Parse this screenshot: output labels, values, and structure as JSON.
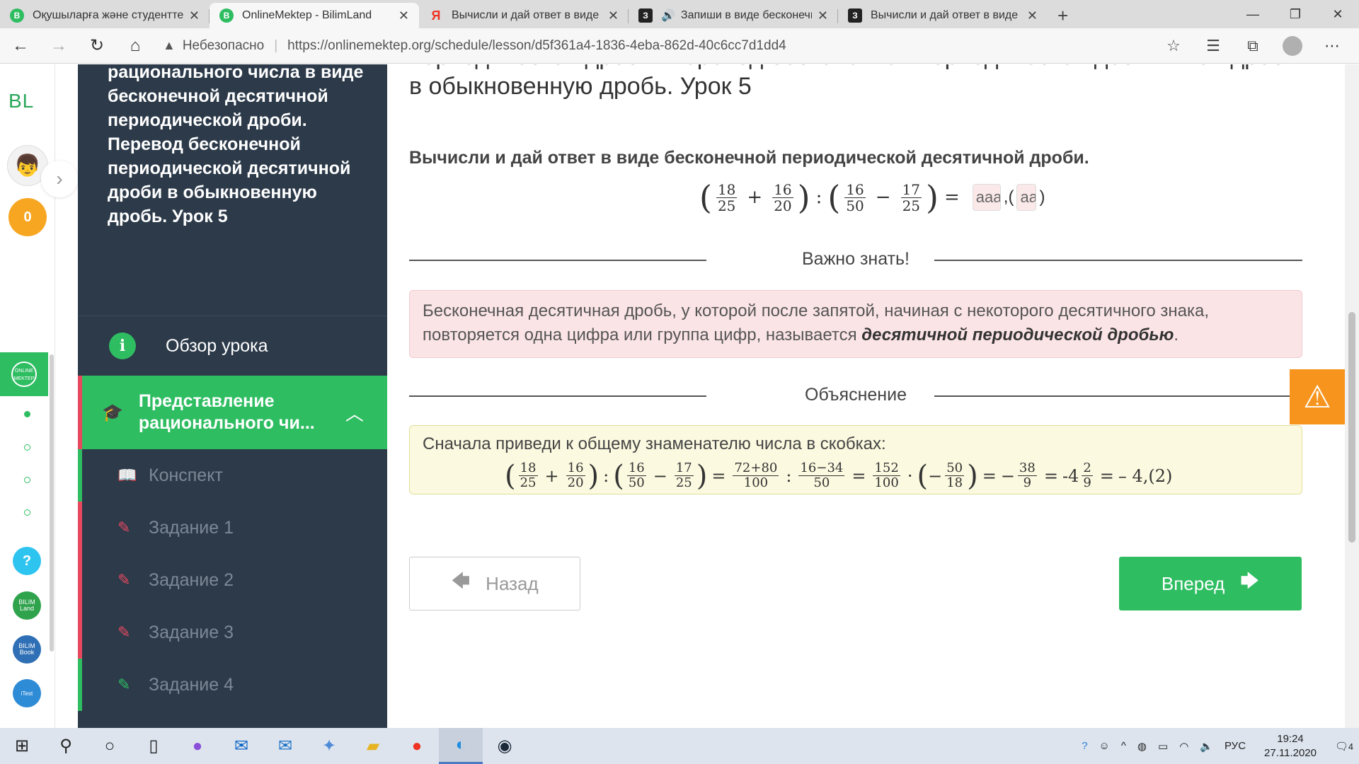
{
  "browser": {
    "tabs": [
      {
        "title": "Оқушыларға және студенттерге",
        "icon_color": "#2fbd62",
        "icon_glyph": "B",
        "active": false
      },
      {
        "title": "OnlineMektep - BilimLand",
        "icon_color": "#2fbd62",
        "icon_glyph": "B",
        "active": true
      },
      {
        "title": "Вычисли и дай ответ в виде бес",
        "icon_color": "#e32",
        "icon_glyph": "Я",
        "active": false
      },
      {
        "title": "Запиши в виде бесконечн",
        "icon_color": "#222",
        "icon_glyph": "З",
        "active": false
      },
      {
        "title": "Вычисли и дай ответ в виде бе",
        "icon_color": "#222",
        "icon_glyph": "З",
        "active": false
      }
    ],
    "insecure_label": "Небезопасно",
    "url": "https://onlinemektep.org/schedule/lesson/d5f361a4-1836-4eba-862d-40c6cc7d1dd4"
  },
  "rail": {
    "logo": "BL",
    "coins": "0",
    "online_mektep_badge": "ONLINE MEKTEP",
    "help": "?",
    "bilimland": "BILIM Land",
    "bilimbook": "BILIM Book",
    "itest": "iTest"
  },
  "sidebar": {
    "title": "Представление рационального числа в виде бесконечной десятичной периодической дроби. Перевод бесконечной периодической десятичной дроби в обыкновенную дробь. Урок 5",
    "overview_label": "Обзор урока",
    "section_label": "Представление рационального чи...",
    "items": [
      {
        "label": "Конспект",
        "icon": "book-icon",
        "bar": "#2fbd62"
      },
      {
        "label": "Задание 1",
        "icon": "edit-icon",
        "bar": "#e8485f"
      },
      {
        "label": "Задание 2",
        "icon": "edit-icon",
        "bar": "#e8485f"
      },
      {
        "label": "Задание 3",
        "icon": "edit-icon",
        "bar": "#e8485f"
      },
      {
        "label": "Задание 4",
        "icon": "edit-icon",
        "bar": "#2fbd62"
      }
    ]
  },
  "main": {
    "lesson_title": "периодической дроби. Перевод бесконечной периодической десятичной дроби в обыкновенную дробь. Урок 5",
    "question": "Вычисли и дай ответ в виде бесконечной периодической десятичной дроби.",
    "formula": {
      "f1": {
        "num": "18",
        "den": "25"
      },
      "f2": {
        "num": "16",
        "den": "20"
      },
      "f3": {
        "num": "16",
        "den": "50"
      },
      "f4": {
        "num": "17",
        "den": "25"
      },
      "answer1_value": "aaa",
      "answer2_value": "aa",
      "comma_paren": ",(",
      "close_paren": ")"
    },
    "important_label": "Важно знать!",
    "note_text": "Бесконечная десятичная дробь, у которой после запятой, начиная с некоторого десятичного знака, повторяется одна цифра или группа цифр, называется ",
    "note_term": "десятичной периодической дробью",
    "note_end": ".",
    "explanation_label": "Объяснение",
    "explanation_text": "Сначала приведи к общему знаменателю числа в скобках:",
    "explanation_math": {
      "a": {
        "num": "18",
        "den": "25"
      },
      "b": {
        "num": "16",
        "den": "20"
      },
      "c": {
        "num": "16",
        "den": "50"
      },
      "d": {
        "num": "17",
        "den": "25"
      },
      "e": {
        "num": "72+80",
        "den": "100"
      },
      "f": {
        "num": "16−34",
        "den": "50"
      },
      "g": {
        "num": "152",
        "den": "100"
      },
      "h": {
        "num": "50",
        "den": "18"
      },
      "i": {
        "num": "38",
        "den": "9"
      },
      "whole": "-4",
      "j": {
        "num": "2",
        "den": "9"
      },
      "result": "– 4,(2)"
    },
    "back_label": "Назад",
    "next_label": "Вперед"
  },
  "taskbar": {
    "language": "РУС",
    "time": "19:24",
    "date": "27.11.2020",
    "notifications": "4"
  }
}
